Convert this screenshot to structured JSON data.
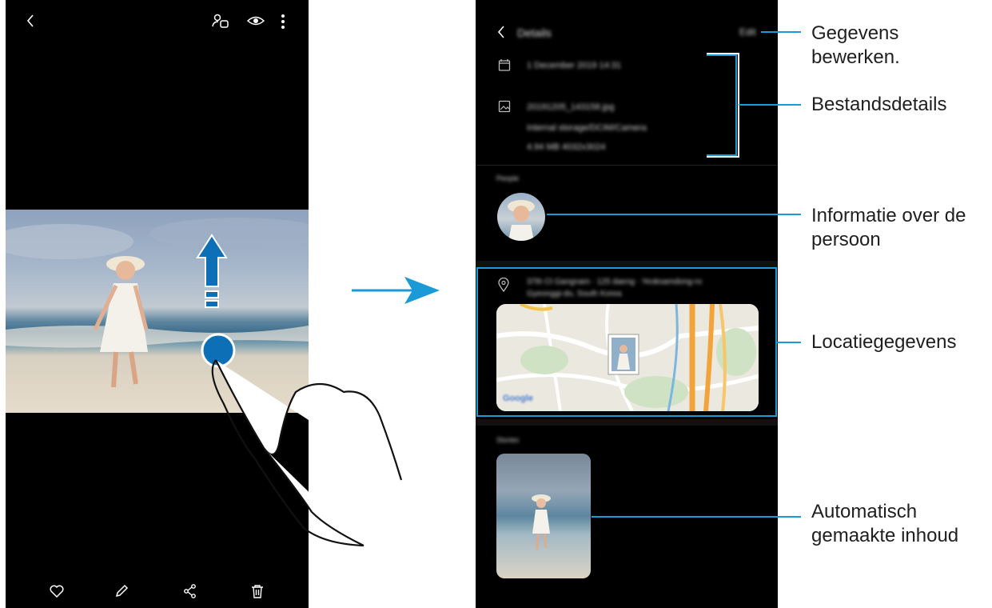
{
  "left_phone": {
    "topbar": {
      "back_icon": "chevron-left-icon",
      "person_icon": "person-tag-icon",
      "eye_icon": "eye-icon",
      "more_icon": "more-vertical-icon"
    },
    "bottombar": {
      "favorite_icon": "heart-icon",
      "edit_icon": "pencil-icon",
      "share_icon": "share-icon",
      "delete_icon": "trash-icon"
    }
  },
  "right_phone": {
    "header": {
      "title": "Details",
      "edit_label": "Edit"
    },
    "date_text": "1 December 2019 14:31",
    "file": {
      "name": "20191205_143158.jpg",
      "path": "Internal storage/DCIM/Camera",
      "size": "4.94 MB    4032x3024"
    },
    "people_label": "People",
    "location_text": "37th Ct Gangnam · 125 daeng · Yeoksamdong-ro",
    "location_text2": "Gyeonggi-do, South Korea",
    "map_brand": "Google",
    "stories_label": "Stories"
  },
  "annotations": {
    "edit_details": [
      "Gegevens",
      "bewerken."
    ],
    "file_details": [
      "Bestandsdetails"
    ],
    "person_info": [
      "Informatie over de",
      "persoon"
    ],
    "location": [
      "Locatiegegevens"
    ],
    "auto_content": [
      "Automatisch",
      "gemaakte inhoud"
    ]
  },
  "colors": {
    "accent": "#1a9ad6",
    "callout": "#0f6fb0"
  }
}
